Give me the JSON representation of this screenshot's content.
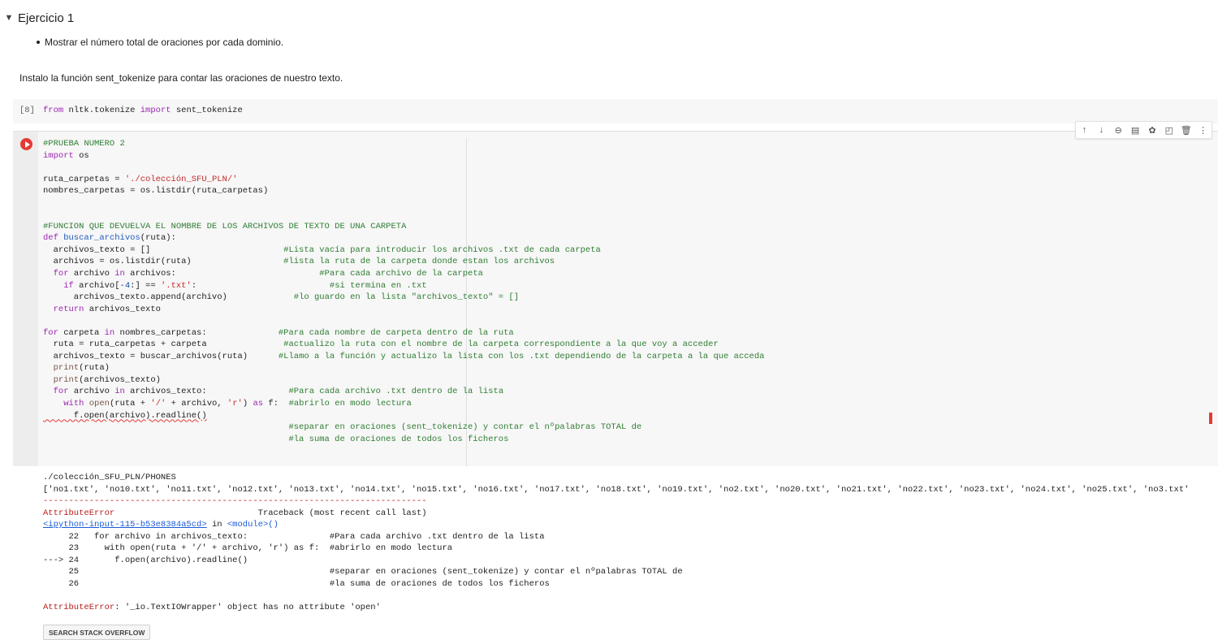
{
  "section": {
    "caret": "▼",
    "title": "Ejercicio 1"
  },
  "bullet": "Mostrar el número total de oraciones por cada dominio.",
  "paragraph": "Instalo la función sent_tokenize para contar las oraciones de nuestro texto.",
  "cell8": {
    "count": "[8]",
    "code_kw1": "from",
    "code_mod": " nltk.tokenize ",
    "code_kw2": "import",
    "code_name": " sent_tokenize"
  },
  "toolbar_icons": [
    "arrow-up-icon",
    "arrow-down-icon",
    "link-icon",
    "comment-icon",
    "gear-icon",
    "mirror-cell-icon",
    "delete-icon",
    "more-icon"
  ],
  "toolbar_glyphs": [
    "↑",
    "↓",
    "⊖",
    "▤",
    "✿",
    "◰",
    "🗑",
    "⋮"
  ],
  "main_code": {
    "l1": "#PRUEBA NUMERO 2",
    "l2_kw": "import",
    "l2_rest": " os",
    "l4_a": "ruta_carpetas = ",
    "l4_s": "'./colección_SFU_PLN/'",
    "l5": "nombres_carpetas = os.listdir(ruta_carpetas)",
    "l8": "#FUNCION QUE DEVUELVA EL NOMBRE DE LOS ARCHIVOS DE TEXTO DE UNA CARPETA",
    "l9_kw": "def",
    "l9_fn": " buscar_archivos",
    "l9_rest": "(ruta):",
    "l10_a": "  archivos_texto = []                          ",
    "l10_c": "#Lista vacía para introducir los archivos .txt de cada carpeta",
    "l11_a": "  archivos = os.listdir(ruta)                  ",
    "l11_c": "#lista la ruta de la carpeta donde estan los archivos",
    "l12_a": "  ",
    "l12_kw1": "for",
    "l12_b": " archivo ",
    "l12_kw2": "in",
    "l12_c": " archivos:                            ",
    "l12_cm": "#Para cada archivo de la carpeta",
    "l13_a": "    ",
    "l13_kw": "if",
    "l13_b": " archivo[",
    "l13_n": "-4",
    "l13_c": ":] == ",
    "l13_s": "'.txt'",
    "l13_d": ":                          ",
    "l13_cm": "#si termina en .txt",
    "l14_a": "      archivos_texto.append(archivo)             ",
    "l14_cm": "#lo guardo en la lista \"archivos_texto\" = []",
    "l15_a": "  ",
    "l15_kw": "return",
    "l15_b": " archivos_texto",
    "l17_kw1": "for",
    "l17_a": " carpeta ",
    "l17_kw2": "in",
    "l17_b": " nombres_carpetas:              ",
    "l17_cm": "#Para cada nombre de carpeta dentro de la ruta",
    "l18_a": "  ruta = ruta_carpetas + carpeta               ",
    "l18_cm": "#actualizo la ruta con el nombre de la carpeta correspondiente a la que voy a acceder",
    "l19_a": "  archivos_texto = buscar_archivos(ruta)      ",
    "l19_cm": "#Llamo a la función y actualizo la lista con los .txt dependiendo de la carpeta a la que acceda",
    "l20_b": "print",
    "l20_r": "(ruta)",
    "l21_b": "print",
    "l21_r": "(archivos_texto)",
    "l22_kw1": "for",
    "l22_a": " archivo ",
    "l22_kw2": "in",
    "l22_b": " archivos_texto:                ",
    "l22_cm": "#Para cada archivo .txt dentro de la lista",
    "l23_kw": "with",
    "l23_b": "open",
    "l23_a": "(ruta + ",
    "l23_s1": "'/'",
    "l23_c": " + archivo, ",
    "l23_s2": "'r'",
    "l23_d": ") ",
    "l23_kw2": "as",
    "l23_e": " f:  ",
    "l23_cm": "#abrirlo en modo lectura",
    "l24": "      f.open(archivo).readline()",
    "l25_cm": "#separar en oraciones (sent_tokenize) y contar el nºpalabras TOTAL de",
    "l26_cm": "#la suma de oraciones de todos los ficheros"
  },
  "output": {
    "path": "./colección_SFU_PLN/PHONES",
    "list": "['no1.txt', 'no10.txt', 'no11.txt', 'no12.txt', 'no13.txt', 'no14.txt', 'no15.txt', 'no16.txt', 'no17.txt', 'no18.txt', 'no19.txt', 'no2.txt', 'no20.txt', 'no21.txt', 'no22.txt', 'no23.txt', 'no24.txt', 'no25.txt', 'no3.txt'",
    "dashes": "---------------------------------------------------------------------------",
    "err_name": "AttributeError",
    "tb_label": "                            Traceback (most recent call last)",
    "input_link": "<ipython-input-115-b53e8384a5cd>",
    "in_text": " in ",
    "module": "<module>",
    "module_paren": "()",
    "tb22": "     22   for archivo in archivos_texto:                #Para cada archivo .txt dentro de la lista",
    "tb23": "     23     with open(ruta + '/' + archivo, 'r') as f:  #abrirlo en modo lectura",
    "tb24": "---> 24       f.open(archivo).readline()",
    "tb25": "     25                                                 #separar en oraciones (sent_tokenize) y contar el nºpalabras TOTAL de",
    "tb26": "     26                                                 #la suma de oraciones de todos los ficheros",
    "final_err": "AttributeError",
    "final_msg": ": '_io.TextIOWrapper' object has no attribute 'open'",
    "so_button": "SEARCH STACK OVERFLOW"
  }
}
